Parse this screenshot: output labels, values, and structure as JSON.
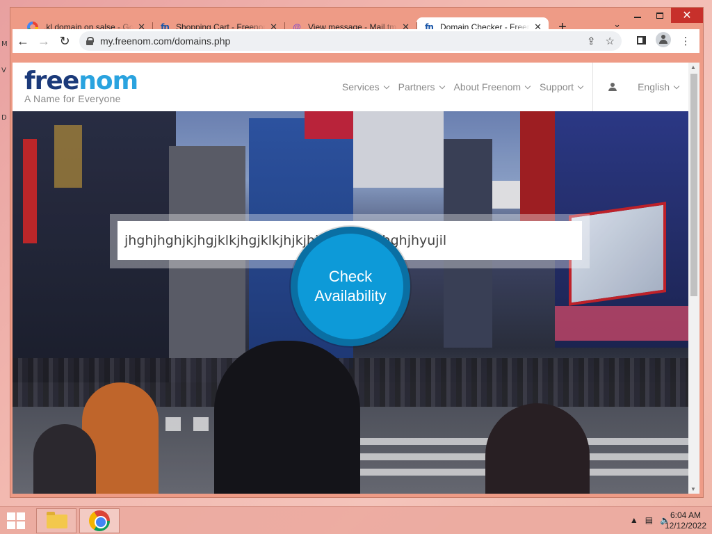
{
  "browser": {
    "tabs": [
      {
        "title": ".kl domain on salse - Go",
        "icon": "google-icon"
      },
      {
        "title": "Shopping Cart - Freenom",
        "icon": "freenom-icon"
      },
      {
        "title": "View message - Mail.tm",
        "icon": "mail-at-icon"
      },
      {
        "title": "Domain Checker - Freenom",
        "icon": "freenom-icon",
        "active": true
      }
    ],
    "new_tab": "+",
    "url": "my.freenom.com/domains.php"
  },
  "site": {
    "logo_a": "free",
    "logo_b": "nom",
    "tagline": "A Name for Everyone",
    "nav": [
      "Services",
      "Partners",
      "About Freenom",
      "Support"
    ],
    "language": "English"
  },
  "hero": {
    "search_value": "jhghjhghjkjhgjklkjhgjklkjhjkjhjkjhgjhgjkjhghjhyujil",
    "check_line1": "Check",
    "check_line2": "Availability"
  },
  "taskbar": {
    "time": "6:04 AM",
    "date": "12/12/2022"
  },
  "colors": {
    "brand_dark": "#1b3a7a",
    "brand_light": "#2aa3df",
    "check_button": "#0d9ad8",
    "window_frame": "#ee9b86",
    "close_button": "#c7302b"
  }
}
